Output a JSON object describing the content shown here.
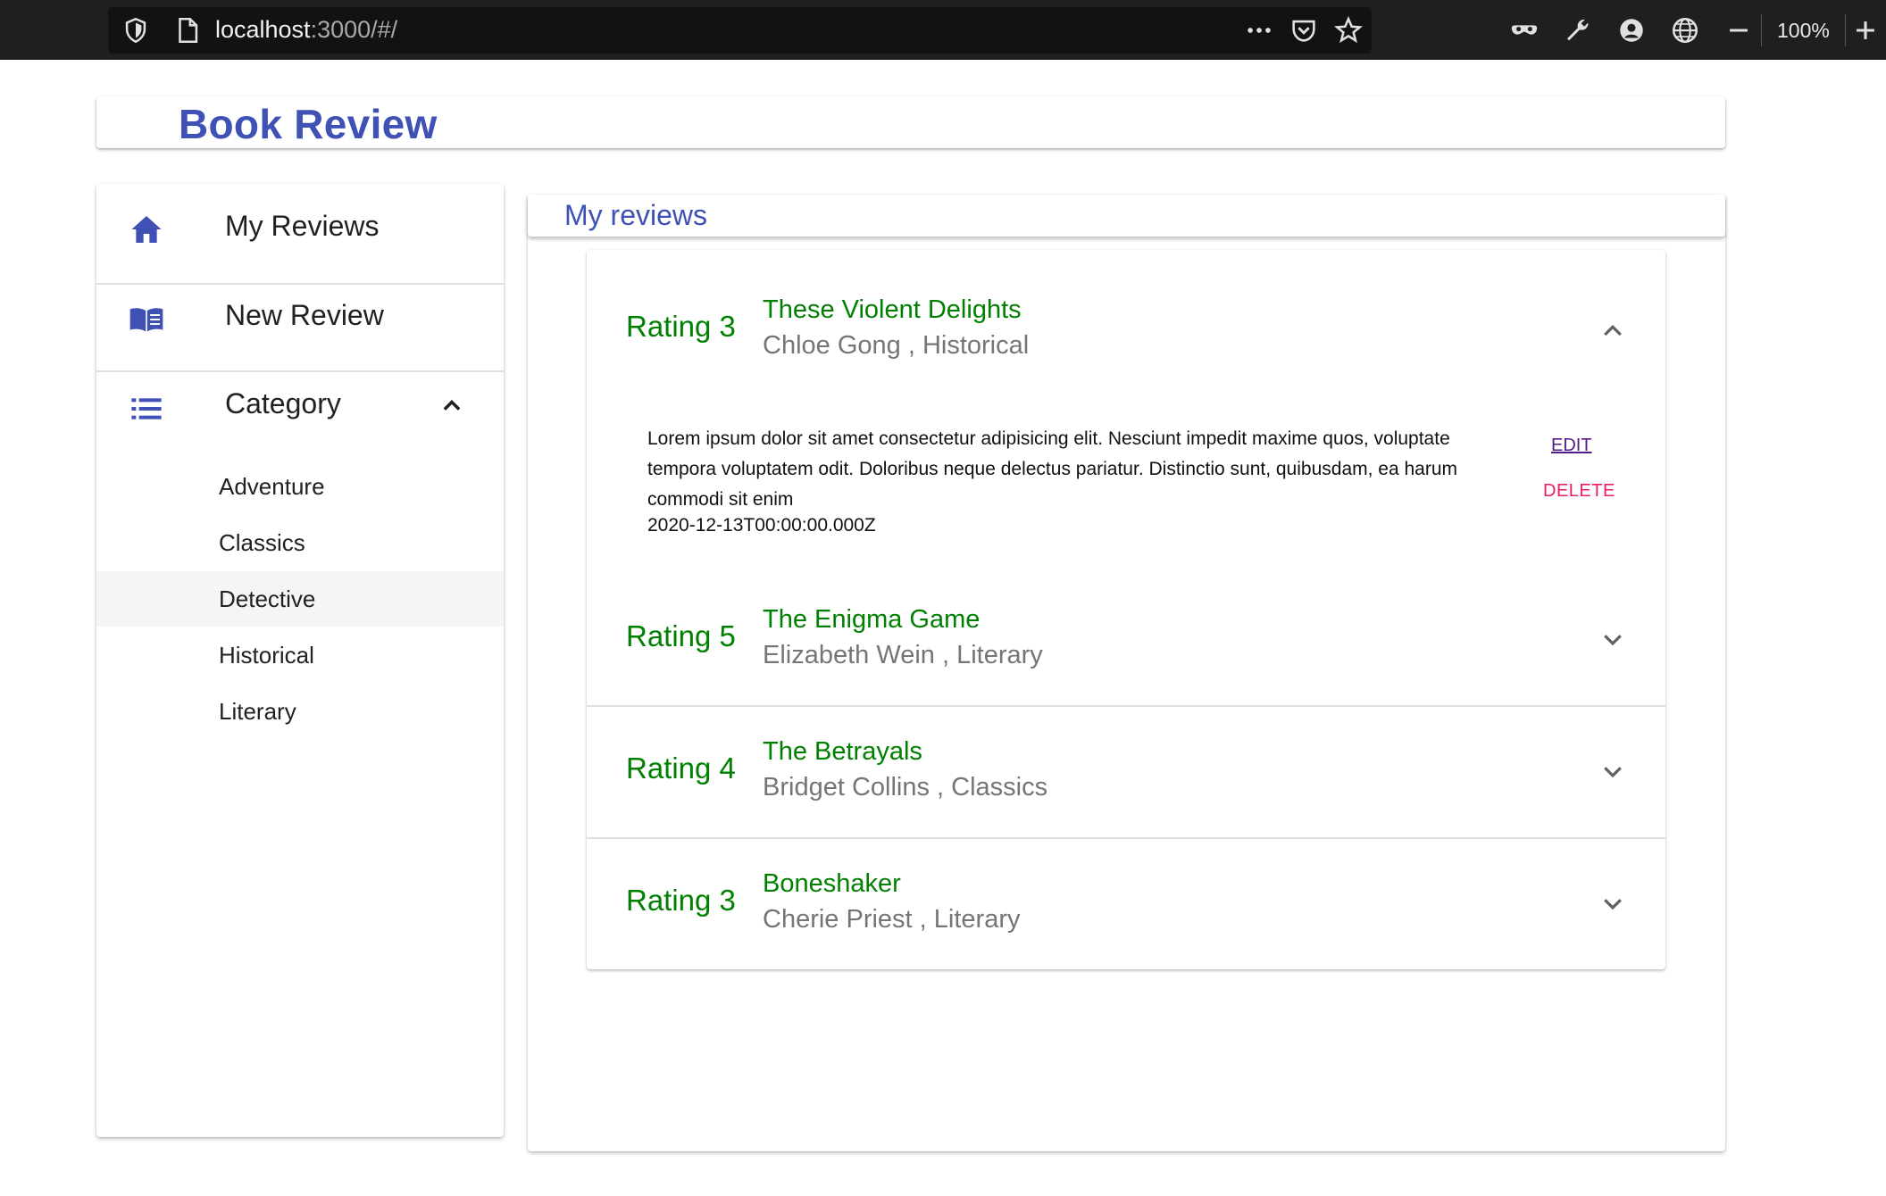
{
  "browser": {
    "url_host": "localhost",
    "url_rest": ":3000/#/",
    "zoom": "100%"
  },
  "app": {
    "title": "Book Review"
  },
  "sidebar": {
    "nav": [
      {
        "label": "My Reviews",
        "icon": "home-icon"
      },
      {
        "label": "New Review",
        "icon": "book-icon"
      },
      {
        "label": "Category",
        "icon": "list-icon",
        "expanded": true
      }
    ],
    "categories": [
      {
        "label": "Adventure",
        "selected": false
      },
      {
        "label": "Classics",
        "selected": false
      },
      {
        "label": "Detective",
        "selected": true
      },
      {
        "label": "Historical",
        "selected": false
      },
      {
        "label": "Literary",
        "selected": false
      }
    ]
  },
  "main": {
    "header": "My reviews",
    "reviews": [
      {
        "rating": "Rating 3",
        "title": "These Violent Delights",
        "subtitle": "Chloe Gong , Historical",
        "expanded": true,
        "text": "Lorem ipsum dolor sit amet consectetur adipisicing elit. Nesciunt impedit maxime quos, voluptate tempora voluptatem odit. Doloribus neque delectus pariatur. Distinctio sunt, quibusdam, ea harum commodi sit enim",
        "date": "2020-12-13T00:00:00.000Z",
        "edit_label": "EDIT",
        "delete_label": "DELETE"
      },
      {
        "rating": "Rating 5",
        "title": "The Enigma Game",
        "subtitle": "Elizabeth Wein , Literary",
        "expanded": false
      },
      {
        "rating": "Rating 4",
        "title": "The Betrayals",
        "subtitle": "Bridget Collins , Classics",
        "expanded": false
      },
      {
        "rating": "Rating 3",
        "title": "Boneshaker",
        "subtitle": "Cherie Priest , Literary",
        "expanded": false
      }
    ]
  },
  "colors": {
    "primary": "#3f51b5",
    "rating_green": "#008000",
    "delete_pink": "#e91e63",
    "edit_purple": "#551a8b"
  }
}
